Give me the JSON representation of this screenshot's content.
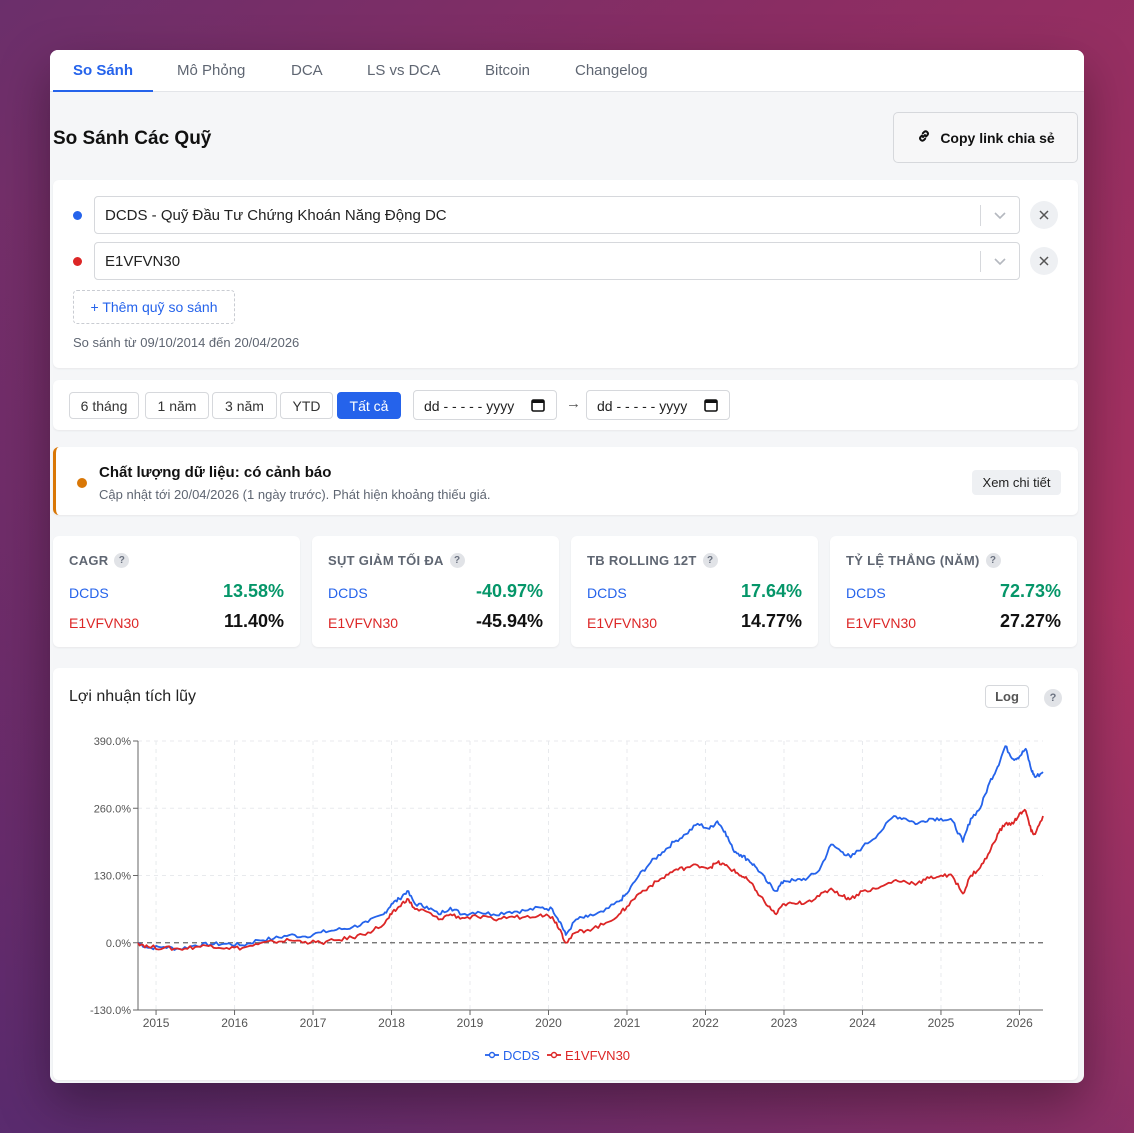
{
  "tabs": [
    "So Sánh",
    "Mô Phỏng",
    "DCA",
    "LS vs DCA",
    "Bitcoin",
    "Changelog"
  ],
  "page_title": "So Sánh Các Quỹ",
  "copy_link_label": "Copy link chia sẻ",
  "funds": [
    {
      "label": "DCDS - Quỹ Đầu Tư Chứng Khoán Năng Động DC",
      "color": "#2563eb"
    },
    {
      "label": "E1VFVN30",
      "color": "#dc2626"
    }
  ],
  "add_fund_label": "+ Thêm quỹ so sánh",
  "compare_range": "So sánh từ 09/10/2014 đến 20/04/2026",
  "range_buttons": [
    "6 tháng",
    "1 năm",
    "3 năm",
    "YTD",
    "Tất cả"
  ],
  "active_range": "Tất cả",
  "date_placeholder": "dd - - - - - yyyy",
  "arrow": "→",
  "data_quality": {
    "title": "Chất lượng dữ liệu: có cảnh báo",
    "subtitle": "Cập nhật tới 20/04/2026 (1 ngày trước). Phát hiện khoảng thiếu giá.",
    "button": "Xem chi tiết",
    "color": "#d97706"
  },
  "stats": [
    {
      "title": "CAGR",
      "f1": "DCDS",
      "v1": "13.58%",
      "f2": "E1VFVN30",
      "v2": "11.40%"
    },
    {
      "title": "SỤT GIẢM TỐI ĐA",
      "f1": "DCDS",
      "v1": "-40.97%",
      "f2": "E1VFVN30",
      "v2": "-45.94%"
    },
    {
      "title": "TB ROLLING 12T",
      "f1": "DCDS",
      "v1": "17.64%",
      "f2": "E1VFVN30",
      "v2": "14.77%"
    },
    {
      "title": "TỶ LỆ THẮNG (NĂM)",
      "f1": "DCDS",
      "v1": "72.73%",
      "f2": "E1VFVN30",
      "v2": "27.27%"
    }
  ],
  "help_mark": "?",
  "chart": {
    "title": "Lợi nhuận tích lũy",
    "log_label": "Log"
  },
  "chart_data": {
    "type": "line",
    "title": "Lợi nhuận tích lũy",
    "y_ticks": [
      "390.0%",
      "260.0%",
      "130.0%",
      "0.0%",
      "-130.0%"
    ],
    "x_ticks": [
      "2015",
      "2016",
      "2017",
      "2018",
      "2019",
      "2020",
      "2021",
      "2022",
      "2023",
      "2024",
      "2025",
      "2026"
    ],
    "ylim": [
      -130,
      390
    ],
    "xlim": [
      2014.77,
      2026.3
    ],
    "grid": true,
    "legend": "bottom",
    "baseline": 0,
    "series": [
      {
        "name": "DCDS",
        "color": "#2563eb",
        "points": [
          [
            2014.77,
            0
          ],
          [
            2014.9,
            -10
          ],
          [
            2015.1,
            -8
          ],
          [
            2015.3,
            -12
          ],
          [
            2015.5,
            -5
          ],
          [
            2015.7,
            -3
          ],
          [
            2015.9,
            -2
          ],
          [
            2016.1,
            -5
          ],
          [
            2016.3,
            5
          ],
          [
            2016.5,
            8
          ],
          [
            2016.7,
            15
          ],
          [
            2016.9,
            12
          ],
          [
            2017.1,
            20
          ],
          [
            2017.3,
            25
          ],
          [
            2017.5,
            30
          ],
          [
            2017.7,
            40
          ],
          [
            2017.9,
            55
          ],
          [
            2018.0,
            75
          ],
          [
            2018.1,
            85
          ],
          [
            2018.2,
            100
          ],
          [
            2018.3,
            75
          ],
          [
            2018.45,
            70
          ],
          [
            2018.6,
            55
          ],
          [
            2018.75,
            68
          ],
          [
            2018.9,
            55
          ],
          [
            2019.1,
            60
          ],
          [
            2019.3,
            55
          ],
          [
            2019.5,
            60
          ],
          [
            2019.7,
            62
          ],
          [
            2019.9,
            68
          ],
          [
            2020.05,
            65
          ],
          [
            2020.15,
            40
          ],
          [
            2020.22,
            15
          ],
          [
            2020.35,
            45
          ],
          [
            2020.5,
            50
          ],
          [
            2020.7,
            60
          ],
          [
            2020.9,
            80
          ],
          [
            2021.0,
            95
          ],
          [
            2021.15,
            130
          ],
          [
            2021.3,
            155
          ],
          [
            2021.45,
            175
          ],
          [
            2021.6,
            195
          ],
          [
            2021.75,
            210
          ],
          [
            2021.9,
            230
          ],
          [
            2022.05,
            220
          ],
          [
            2022.15,
            235
          ],
          [
            2022.25,
            215
          ],
          [
            2022.35,
            180
          ],
          [
            2022.45,
            170
          ],
          [
            2022.55,
            160
          ],
          [
            2022.65,
            145
          ],
          [
            2022.8,
            115
          ],
          [
            2022.9,
            100
          ],
          [
            2023.0,
            120
          ],
          [
            2023.15,
            120
          ],
          [
            2023.3,
            125
          ],
          [
            2023.45,
            140
          ],
          [
            2023.6,
            190
          ],
          [
            2023.75,
            175
          ],
          [
            2023.85,
            165
          ],
          [
            2024.0,
            185
          ],
          [
            2024.2,
            210
          ],
          [
            2024.4,
            245
          ],
          [
            2024.55,
            240
          ],
          [
            2024.7,
            230
          ],
          [
            2024.85,
            240
          ],
          [
            2025.0,
            240
          ],
          [
            2025.15,
            235
          ],
          [
            2025.28,
            195
          ],
          [
            2025.38,
            240
          ],
          [
            2025.5,
            260
          ],
          [
            2025.62,
            310
          ],
          [
            2025.72,
            340
          ],
          [
            2025.82,
            380
          ],
          [
            2025.92,
            355
          ],
          [
            2026.0,
            360
          ],
          [
            2026.08,
            375
          ],
          [
            2026.15,
            335
          ],
          [
            2026.2,
            320
          ],
          [
            2026.3,
            330
          ]
        ]
      },
      {
        "name": "E1VFVN30",
        "color": "#dc2626",
        "points": [
          [
            2014.77,
            0
          ],
          [
            2014.9,
            -8
          ],
          [
            2015.1,
            -10
          ],
          [
            2015.3,
            -12
          ],
          [
            2015.5,
            -8
          ],
          [
            2015.7,
            -5
          ],
          [
            2015.9,
            -10
          ],
          [
            2016.1,
            -10
          ],
          [
            2016.3,
            -3
          ],
          [
            2016.5,
            2
          ],
          [
            2016.7,
            5
          ],
          [
            2016.9,
            2
          ],
          [
            2017.1,
            0
          ],
          [
            2017.3,
            5
          ],
          [
            2017.5,
            10
          ],
          [
            2017.7,
            20
          ],
          [
            2017.9,
            35
          ],
          [
            2018.0,
            55
          ],
          [
            2018.1,
            70
          ],
          [
            2018.2,
            85
          ],
          [
            2018.3,
            65
          ],
          [
            2018.45,
            60
          ],
          [
            2018.6,
            45
          ],
          [
            2018.75,
            55
          ],
          [
            2018.9,
            48
          ],
          [
            2019.1,
            50
          ],
          [
            2019.3,
            45
          ],
          [
            2019.5,
            50
          ],
          [
            2019.7,
            50
          ],
          [
            2019.9,
            55
          ],
          [
            2020.05,
            50
          ],
          [
            2020.15,
            25
          ],
          [
            2020.22,
            0
          ],
          [
            2020.35,
            20
          ],
          [
            2020.5,
            25
          ],
          [
            2020.7,
            35
          ],
          [
            2020.9,
            55
          ],
          [
            2021.0,
            70
          ],
          [
            2021.15,
            95
          ],
          [
            2021.3,
            110
          ],
          [
            2021.45,
            125
          ],
          [
            2021.6,
            140
          ],
          [
            2021.75,
            145
          ],
          [
            2021.9,
            150
          ],
          [
            2022.05,
            145
          ],
          [
            2022.15,
            155
          ],
          [
            2022.25,
            150
          ],
          [
            2022.35,
            140
          ],
          [
            2022.45,
            130
          ],
          [
            2022.55,
            120
          ],
          [
            2022.65,
            100
          ],
          [
            2022.8,
            70
          ],
          [
            2022.9,
            55
          ],
          [
            2023.0,
            75
          ],
          [
            2023.15,
            75
          ],
          [
            2023.3,
            80
          ],
          [
            2023.45,
            90
          ],
          [
            2023.6,
            105
          ],
          [
            2023.75,
            90
          ],
          [
            2023.85,
            85
          ],
          [
            2024.0,
            100
          ],
          [
            2024.2,
            105
          ],
          [
            2024.4,
            120
          ],
          [
            2024.55,
            118
          ],
          [
            2024.7,
            115
          ],
          [
            2024.85,
            125
          ],
          [
            2025.0,
            130
          ],
          [
            2025.15,
            128
          ],
          [
            2025.28,
            95
          ],
          [
            2025.38,
            130
          ],
          [
            2025.5,
            145
          ],
          [
            2025.62,
            175
          ],
          [
            2025.72,
            210
          ],
          [
            2025.82,
            230
          ],
          [
            2025.92,
            230
          ],
          [
            2026.0,
            250
          ],
          [
            2026.08,
            255
          ],
          [
            2026.15,
            215
          ],
          [
            2026.2,
            210
          ],
          [
            2026.3,
            245
          ]
        ]
      }
    ]
  }
}
